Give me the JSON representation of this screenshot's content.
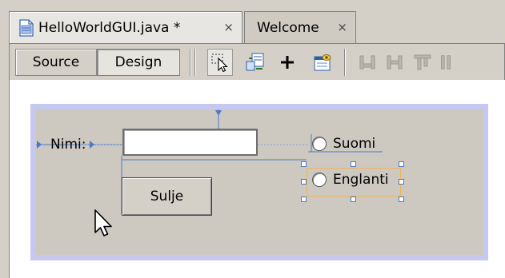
{
  "tabs": [
    {
      "label": "HelloWorldGUI.java *",
      "close": "×",
      "active": true
    },
    {
      "label": "Welcome",
      "close": "×",
      "active": false
    }
  ],
  "toolbar": {
    "source_label": "Source",
    "design_label": "Design",
    "tools": [
      "selection-mode-icon",
      "connection-mode-icon",
      "add-component-icon",
      "preview-design-icon",
      "align-left-icon",
      "align-right-icon",
      "align-top-icon",
      "align-bottom-icon"
    ]
  },
  "form": {
    "nimi_label": "Nimi:",
    "name_field_value": "",
    "close_button_label": "Sulje",
    "radio_suomi_label": "Suomi",
    "radio_englanti_label": "Englanti",
    "selected_component": "Englanti"
  },
  "colors": {
    "guide_blue": "#4b79c8",
    "selection_orange": "#f0b35a",
    "form_border": "#c7c8ef",
    "form_background": "#cdc9c1"
  }
}
